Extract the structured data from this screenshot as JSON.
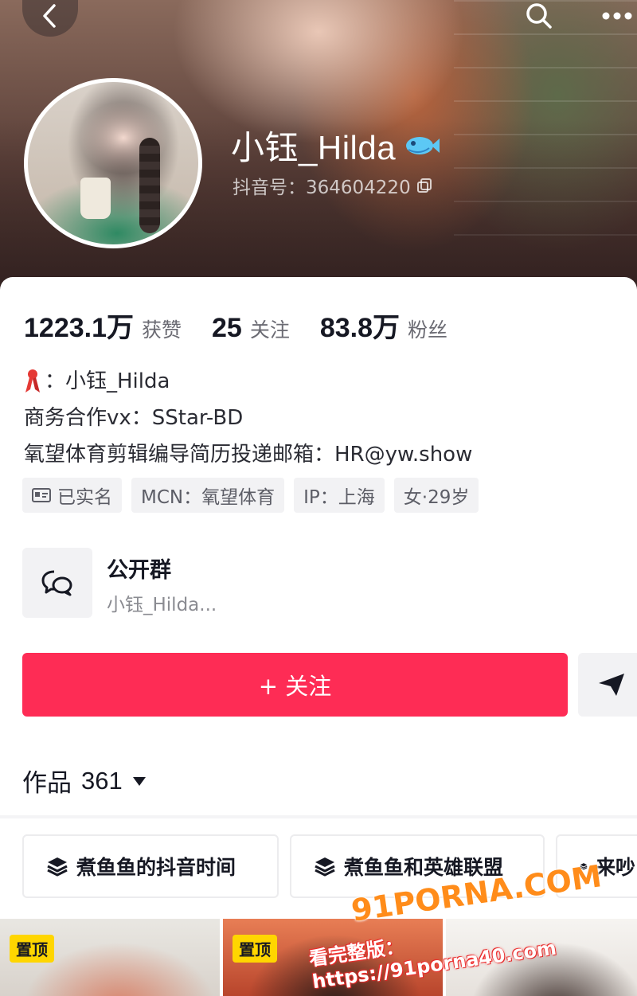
{
  "profile": {
    "nickname": "小钰_Hilda",
    "douyin_id": "抖音号：364604220",
    "avatar_icon": "avatar-photo",
    "badge_icon": "fish-badge-icon"
  },
  "stats": [
    {
      "value": "1223.1万",
      "label": "获赞"
    },
    {
      "value": "25",
      "label": "关注"
    },
    {
      "value": "83.8万",
      "label": "粉丝"
    }
  ],
  "bio": {
    "line1": "：小钰_Hilda",
    "line2": "商务合作vx：SStar-BD",
    "line3": "氧望体育剪辑编导简历投递邮箱：HR@yw.show"
  },
  "tags": [
    "已实名",
    "MCN：氧望体育",
    "IP：上海",
    "女·29岁"
  ],
  "group": {
    "title": "公开群",
    "subtitle": "小钰_Hilda..."
  },
  "actions": {
    "follow_label": "+ 关注"
  },
  "works": {
    "label": "作品",
    "count": "361"
  },
  "collections": [
    "煮鱼鱼的抖音时间",
    "煮鱼鱼和英雄联盟",
    "来吵"
  ],
  "thumbs": [
    {
      "pin": "置顶"
    },
    {
      "pin": "置顶"
    },
    {
      "pin": ""
    }
  ],
  "watermark": {
    "brand": "91PORNA.COM",
    "url": "看完整版：https://91porna40.com"
  },
  "colors": {
    "accent": "#fe2c55",
    "pin": "#ffd600"
  }
}
